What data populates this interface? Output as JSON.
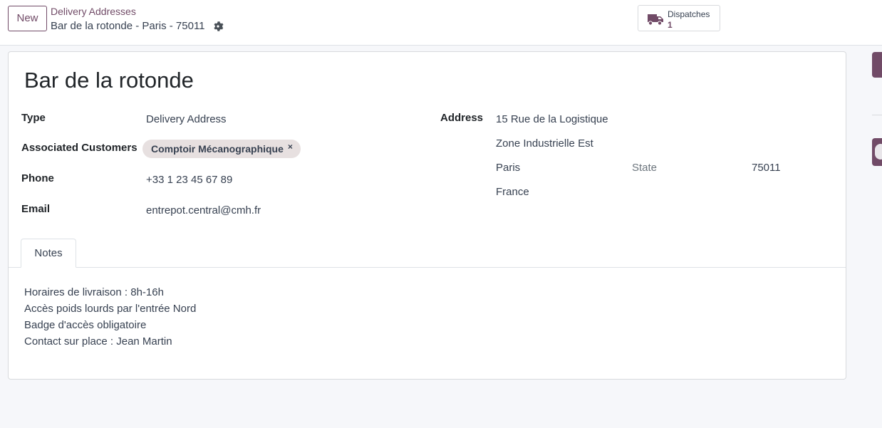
{
  "header": {
    "new_label": "New",
    "breadcrumb_parent": "Delivery Addresses",
    "breadcrumb_current": "Bar de la rotonde - Paris - 75011"
  },
  "smart_button": {
    "label": "Dispatches",
    "count": "1"
  },
  "record": {
    "title": "Bar de la rotonde",
    "type_label": "Type",
    "type_value": "Delivery Address",
    "customers_label": "Associated Customers",
    "customer_tag": "Comptoir Mécanographique",
    "phone_label": "Phone",
    "phone_value": "+33 1 23 45 67 89",
    "email_label": "Email",
    "email_value": "entrepot.central@cmh.fr",
    "address_label": "Address",
    "street": "15 Rue de la Logistique",
    "street2": "Zone Industrielle Est",
    "city": "Paris",
    "state_placeholder": "State",
    "zip": "75011",
    "country": "France"
  },
  "tabs": [
    {
      "label": "Notes"
    }
  ],
  "notes": [
    "Horaires de livraison : 8h-16h",
    "Accès poids lourds par l'entrée Nord",
    "Badge d'accès obligatoire",
    "Contact sur place : Jean Martin"
  ],
  "colors": {
    "accent": "#714b67",
    "tag_bg": "#e7e0e0"
  }
}
